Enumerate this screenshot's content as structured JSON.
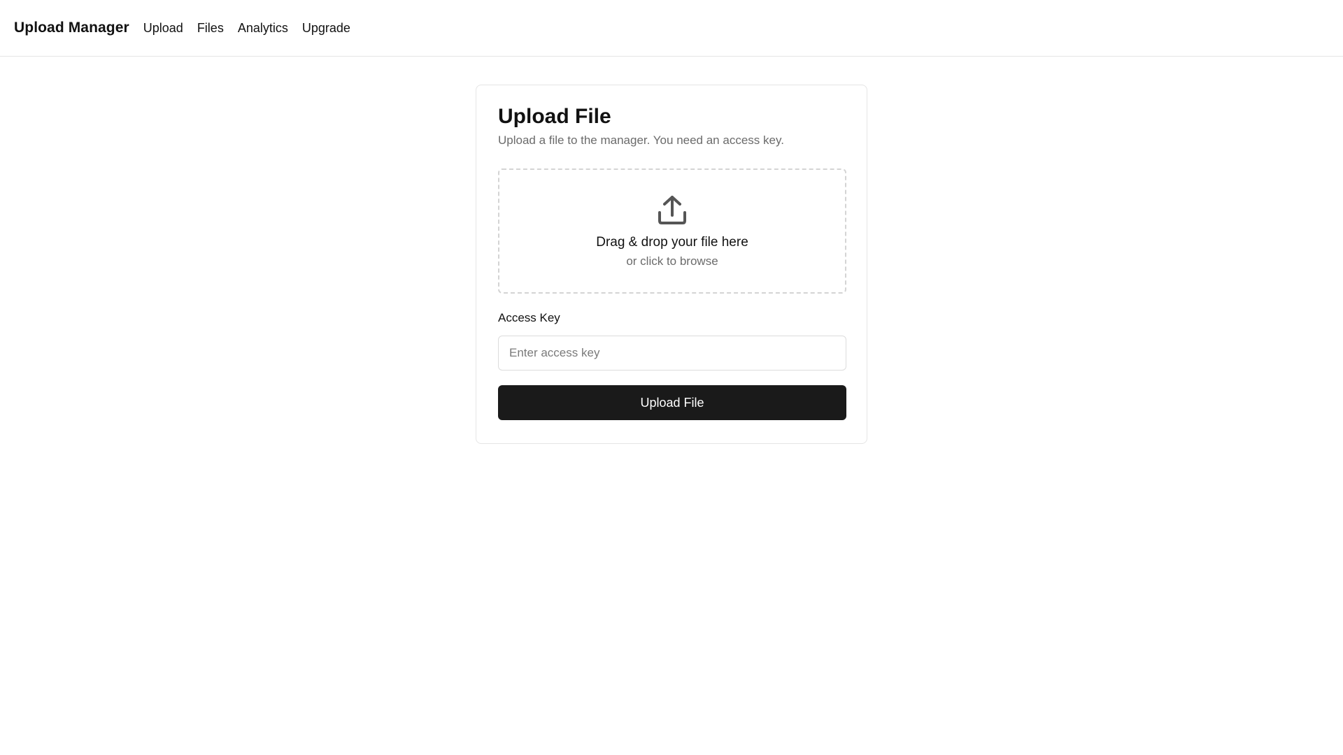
{
  "header": {
    "brand": "Upload Manager",
    "nav": [
      {
        "label": "Upload"
      },
      {
        "label": "Files"
      },
      {
        "label": "Analytics"
      },
      {
        "label": "Upgrade"
      }
    ]
  },
  "card": {
    "title": "Upload File",
    "subtitle": "Upload a file to the manager. You need an access key.",
    "dropzone": {
      "icon": "upload-icon",
      "title": "Drag & drop your file here",
      "subtitle": "or click to browse"
    },
    "access_key": {
      "label": "Access Key",
      "placeholder": "Enter access key",
      "value": ""
    },
    "submit_label": "Upload File"
  },
  "colors": {
    "primary_button": "#1a1a1a",
    "muted_text": "#6b6b6b",
    "border": "#e5e5e5"
  }
}
